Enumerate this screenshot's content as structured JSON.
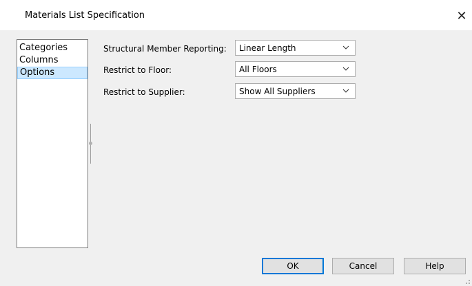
{
  "window": {
    "title": "Materials List Specification",
    "close_label": "✕"
  },
  "nav": {
    "items": [
      {
        "label": "Categories",
        "selected": false
      },
      {
        "label": "Columns",
        "selected": false
      },
      {
        "label": "Options",
        "selected": true
      }
    ]
  },
  "options": {
    "structural_label": "Structural Member Reporting:",
    "structural_value": "Linear Length",
    "floor_label": "Restrict to Floor:",
    "floor_value": "All Floors",
    "supplier_label": "Restrict to Supplier:",
    "supplier_value": "Show All Suppliers"
  },
  "buttons": {
    "ok": "OK",
    "cancel": "Cancel",
    "help": "Help"
  },
  "colors": {
    "selection_fill": "#cce8ff",
    "default_button_border": "#0078d7"
  },
  "icons": {
    "dropdown": "chevron-down-icon",
    "close": "close-icon",
    "resize": "resize-grip-icon"
  }
}
